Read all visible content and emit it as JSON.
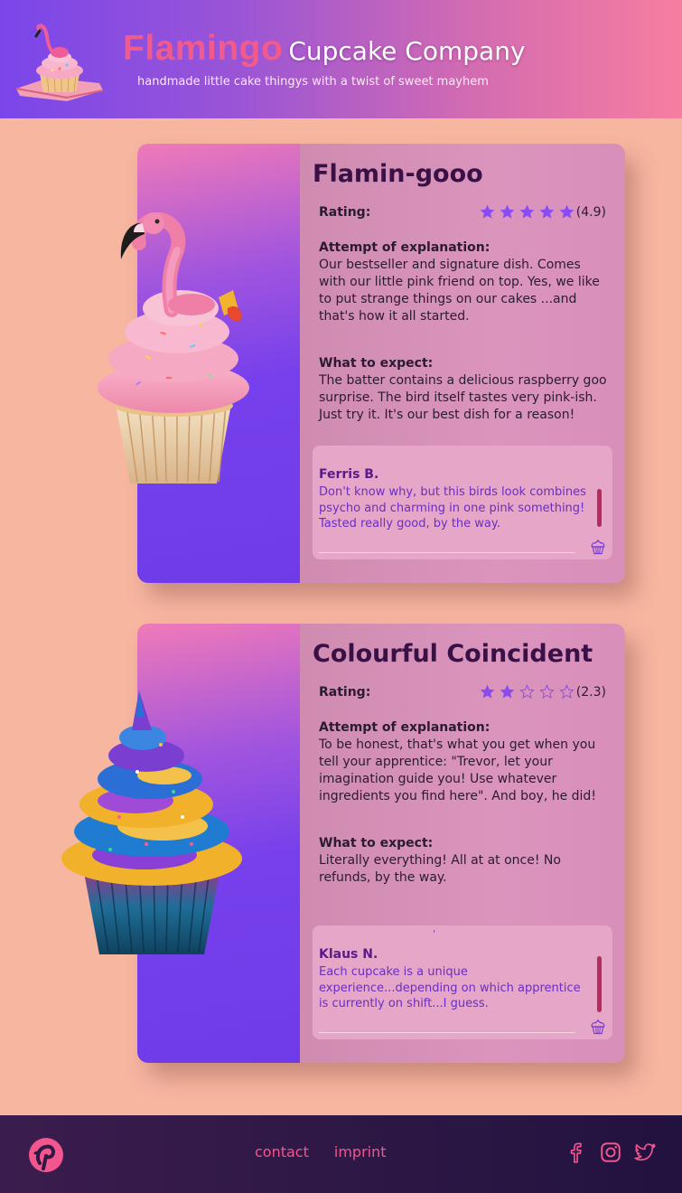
{
  "header": {
    "brand_main": "Flamingo",
    "brand_rest": "Cupcake Company",
    "tagline": "handmade little cake thingys with a twist of sweet mayhem"
  },
  "products": [
    {
      "title": "Flamin-gooo",
      "rating_label": "Rating:",
      "rating": 4.9,
      "rating_text": "(4.9)",
      "stars_filled": 5,
      "explanation_label": "Attempt of explanation:",
      "explanation": "Our bestseller and signature dish. Comes with our little pink friend on top. Yes, we like to put strange things on our cakes ...and that's how it all started.",
      "expect_label": "What to expect:",
      "expect": "The batter contains a delicious raspberry goo surprise. The bird itself tastes very pink-ish. Just try it. It's our best dish for a reason!",
      "review": {
        "name": "Ferris B.",
        "text": "Don't know why, but this birds look combines psycho and charming in one pink something! Tasted really good, by the way."
      },
      "image_icon": "flamingo-cupcake-image"
    },
    {
      "title": "Colourful Coincident",
      "rating_label": "Rating:",
      "rating": 2.3,
      "rating_text": "(2.3)",
      "stars_filled": 2,
      "explanation_label": "Attempt of explanation:",
      "explanation": "To be honest, that's what you get when you tell your apprentice: \"Trevor, let your imagination guide you! Use whatever ingredients you find here\". And boy, he did!",
      "expect_label": "What to expect:",
      "expect": "Literally everything! All at at once! No refunds, by the way.",
      "review": {
        "tick": "'",
        "name": "Klaus N.",
        "text": "Each cupcake is a unique experience...depending on which apprentice is currently on shift...I guess."
      },
      "image_icon": "colourful-cupcake-image"
    }
  ],
  "footer": {
    "links": [
      "contact",
      "imprint"
    ],
    "socials": [
      "facebook-icon",
      "instagram-icon",
      "twitter-icon"
    ]
  },
  "colors": {
    "background": "#f7b6a0",
    "accent_pink": "#f2568e",
    "purple": "#6f3be9",
    "star": "#8a4cf0"
  }
}
